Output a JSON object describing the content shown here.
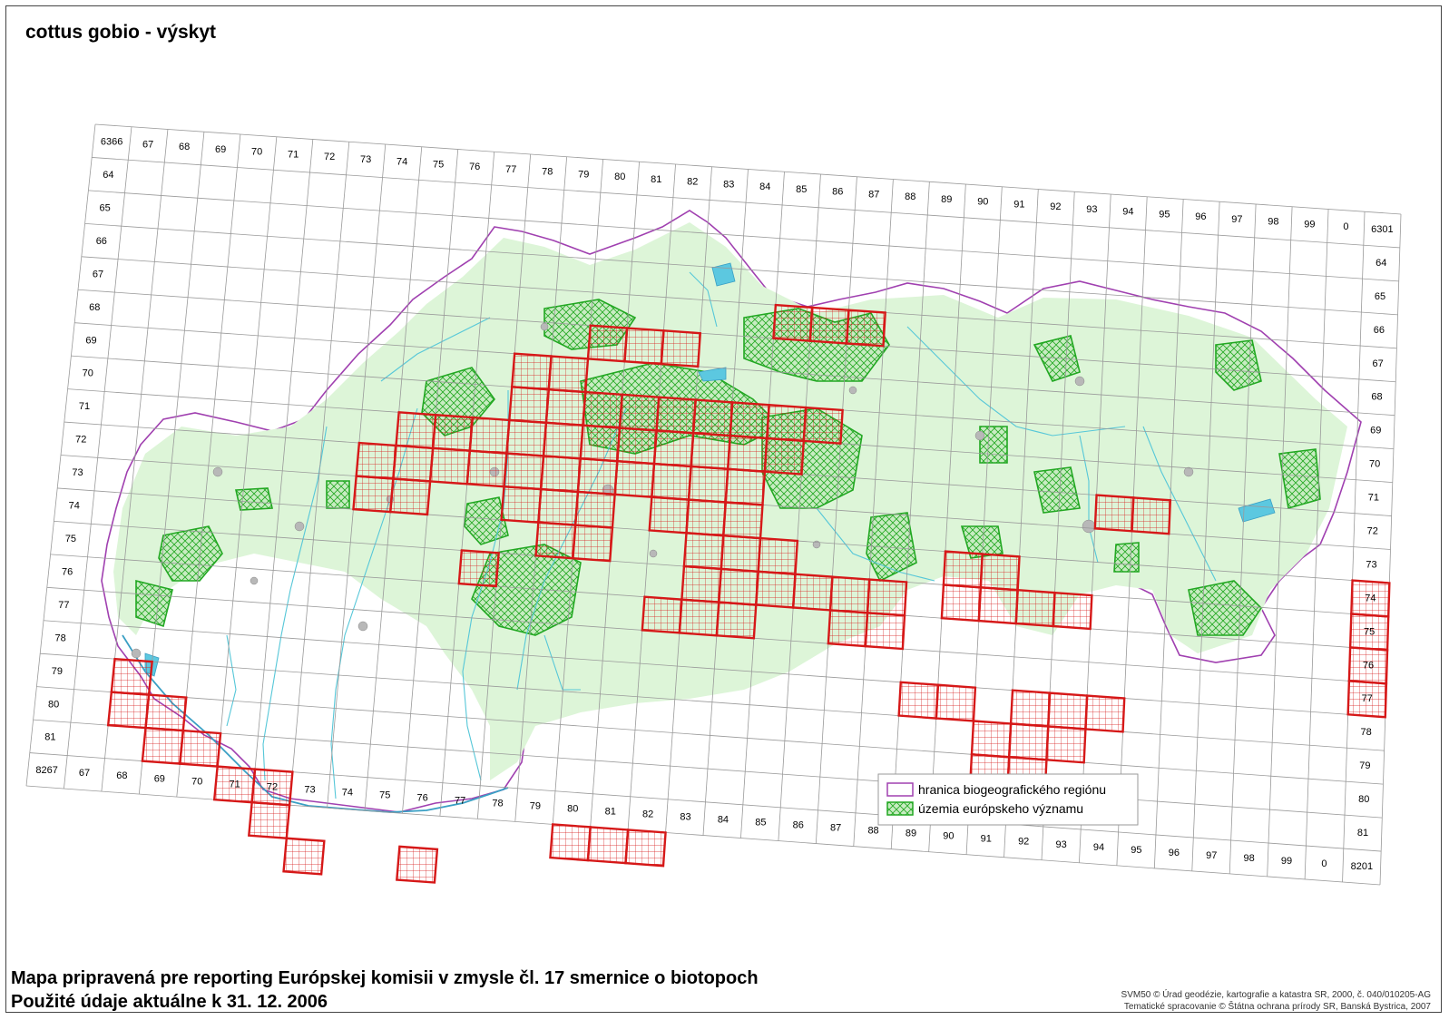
{
  "title": "cottus gobio - výskyt",
  "footer": {
    "line1": "Mapa pripravená pre reporting Európskej komisii v zmysle čl. 17 smernice o biotopoch",
    "line2": "Použité údaje aktuálne k 31. 12. 2006",
    "credit1": "SVM50 © Úrad geodézie, kartografie a katastra SR, 2000, č. 040/010205-AG",
    "credit2": "Tematické spracovanie © Štátna ochrana prírody SR, Banská Bystrica, 2007"
  },
  "legend": {
    "items": [
      {
        "label": "hranica biogeografického regiónu",
        "symbol": "purple-outline"
      },
      {
        "label": "územia európskeho významu",
        "symbol": "green-hatch"
      }
    ]
  },
  "colors": {
    "region_border": "#a040b0",
    "n2k_sites": "#22a822",
    "occurrence": "#d61818",
    "rivers": "#56c7d8",
    "land_tint": "#ddf5d8"
  },
  "grid": {
    "top_labels": [
      "6366",
      "67",
      "68",
      "69",
      "70",
      "71",
      "72",
      "73",
      "74",
      "75",
      "76",
      "77",
      "78",
      "79",
      "80",
      "81",
      "82",
      "83",
      "84",
      "85",
      "86",
      "87",
      "88",
      "89",
      "90",
      "91",
      "92",
      "93",
      "94",
      "95",
      "96",
      "97",
      "98",
      "99",
      "0",
      "6301"
    ],
    "bottom_labels": [
      "8267",
      "67",
      "68",
      "69",
      "70",
      "71",
      "72",
      "73",
      "74",
      "75",
      "76",
      "77",
      "78",
      "79",
      "80",
      "81",
      "82",
      "83",
      "84",
      "85",
      "86",
      "87",
      "88",
      "89",
      "90",
      "91",
      "92",
      "93",
      "94",
      "95",
      "96",
      "97",
      "98",
      "99",
      "0",
      "8201"
    ],
    "left_labels": [
      "64",
      "65",
      "66",
      "67",
      "68",
      "69",
      "70",
      "71",
      "72",
      "73",
      "74",
      "75",
      "76",
      "77",
      "78",
      "79",
      "80",
      "81"
    ],
    "right_labels": [
      "64",
      "65",
      "66",
      "67",
      "68",
      "69",
      "70",
      "71",
      "72",
      "73",
      "74",
      "75",
      "76",
      "77",
      "78",
      "79",
      "80",
      "81"
    ]
  },
  "occurrence_cells": [
    [
      12,
      4
    ],
    [
      13,
      4
    ],
    [
      14,
      4
    ],
    [
      17,
      3
    ],
    [
      18,
      3
    ],
    [
      19,
      3
    ],
    [
      10,
      5
    ],
    [
      11,
      5
    ],
    [
      10,
      6
    ],
    [
      11,
      6
    ],
    [
      12,
      6
    ],
    [
      13,
      6
    ],
    [
      14,
      6
    ],
    [
      15,
      6
    ],
    [
      16,
      6
    ],
    [
      17,
      6
    ],
    [
      18,
      6
    ],
    [
      7,
      7
    ],
    [
      8,
      7
    ],
    [
      9,
      7
    ],
    [
      10,
      7
    ],
    [
      11,
      7
    ],
    [
      12,
      7
    ],
    [
      13,
      7
    ],
    [
      14,
      7
    ],
    [
      15,
      7
    ],
    [
      16,
      7
    ],
    [
      17,
      7
    ],
    [
      6,
      8
    ],
    [
      7,
      8
    ],
    [
      8,
      8
    ],
    [
      9,
      8
    ],
    [
      10,
      8
    ],
    [
      11,
      8
    ],
    [
      12,
      8
    ],
    [
      13,
      8
    ],
    [
      14,
      8
    ],
    [
      15,
      8
    ],
    [
      16,
      8
    ],
    [
      6,
      9
    ],
    [
      7,
      9
    ],
    [
      10,
      9
    ],
    [
      11,
      9
    ],
    [
      12,
      9
    ],
    [
      14,
      9
    ],
    [
      15,
      9
    ],
    [
      16,
      9
    ],
    [
      11,
      10
    ],
    [
      12,
      10
    ],
    [
      15,
      10
    ],
    [
      16,
      10
    ],
    [
      17,
      10
    ],
    [
      22,
      10
    ],
    [
      23,
      10
    ],
    [
      9,
      11
    ],
    [
      15,
      11
    ],
    [
      16,
      11
    ],
    [
      17,
      11
    ],
    [
      18,
      11
    ],
    [
      19,
      11
    ],
    [
      20,
      11
    ],
    [
      22,
      11
    ],
    [
      23,
      11
    ],
    [
      24,
      11
    ],
    [
      25,
      11
    ],
    [
      14,
      12
    ],
    [
      15,
      12
    ],
    [
      16,
      12
    ],
    [
      19,
      12
    ],
    [
      20,
      12
    ],
    [
      21,
      14
    ],
    [
      22,
      14
    ],
    [
      24,
      14
    ],
    [
      25,
      14
    ],
    [
      26,
      14
    ],
    [
      23,
      15
    ],
    [
      24,
      15
    ],
    [
      25,
      15
    ],
    [
      23,
      16
    ],
    [
      24,
      16
    ],
    [
      33,
      10
    ],
    [
      33,
      11
    ],
    [
      33,
      12
    ],
    [
      33,
      13
    ],
    [
      26,
      8
    ],
    [
      27,
      8
    ],
    [
      0,
      15
    ],
    [
      0,
      16
    ],
    [
      1,
      16
    ],
    [
      1,
      17
    ],
    [
      2,
      17
    ],
    [
      3,
      18
    ],
    [
      4,
      18
    ],
    [
      4,
      19
    ],
    [
      5,
      20
    ],
    [
      8,
      20
    ],
    [
      12,
      19
    ],
    [
      13,
      19
    ],
    [
      14,
      19
    ]
  ]
}
